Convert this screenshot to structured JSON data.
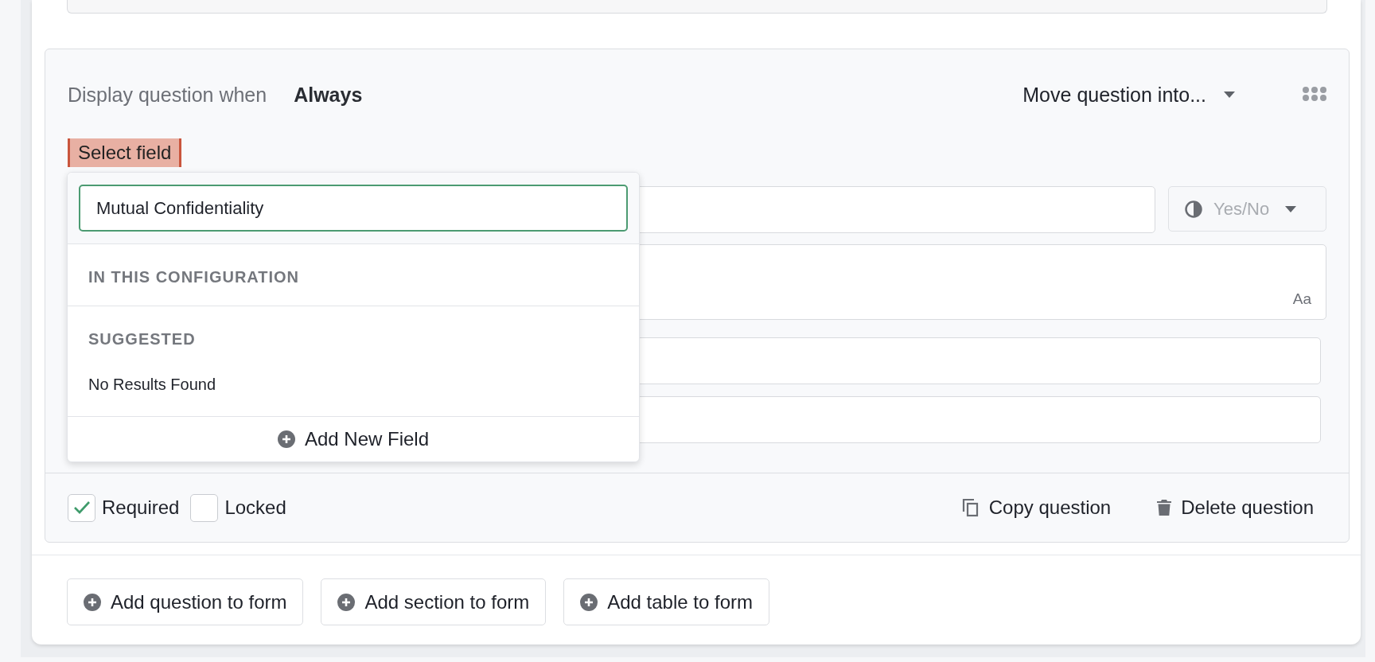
{
  "question": {
    "display_label": "Display question when",
    "display_value": "Always",
    "move_menu": "Move question into...",
    "field_label": "Select field",
    "type_select": "Yes/No",
    "text_hint": "Aa"
  },
  "field_picker": {
    "search_value": "Mutual Confidentiality",
    "sections": [
      {
        "heading": "IN THIS CONFIGURATION"
      },
      {
        "heading": "SUGGESTED",
        "message": "No Results Found"
      }
    ],
    "add_button": "Add New Field"
  },
  "options": [
    {
      "label": "Required",
      "checked": true
    },
    {
      "label": "Locked",
      "checked": false
    }
  ],
  "actions": [
    {
      "kind": "copy",
      "label": "Copy question"
    },
    {
      "kind": "delete",
      "label": "Delete question"
    }
  ],
  "form_buttons": [
    "Add question to form",
    "Add section to form",
    "Add table to form"
  ]
}
